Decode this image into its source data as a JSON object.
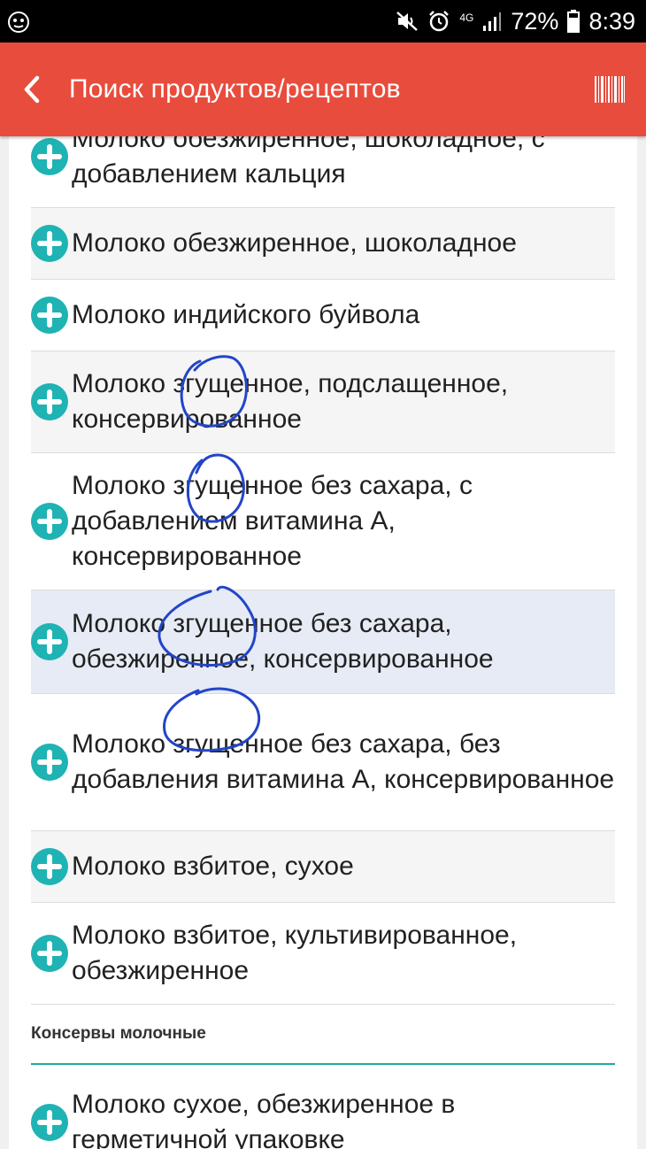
{
  "status_bar": {
    "signal_label": "4G",
    "battery_text": "72%",
    "time": "8:39"
  },
  "app_bar": {
    "title": "Поиск продуктов/рецептов"
  },
  "list": {
    "items": [
      {
        "label": "Молоко обезжиренное, шоколадное, с добавлением кальция"
      },
      {
        "label": "Молоко обезжиренное, шоколадное"
      },
      {
        "label": "Молоко индийского буйвола"
      },
      {
        "label": "Молоко згущенное, подслащенное, консервированное"
      },
      {
        "label": "Молоко згущенное без сахара, с добавлением витамина А, консервированное"
      },
      {
        "label": "Молоко згущенное без сахара, обезжиренное, консервированное"
      },
      {
        "label": "Молоко згущенное без сахара, без добавления витамина А, консервированное"
      },
      {
        "label": "Молоко взбитое, сухое"
      },
      {
        "label": "Молоко взбитое, культивированное, обезжиренное"
      }
    ],
    "section_header": "Консервы молочные",
    "section_items": [
      {
        "label": "Молоко сухое, обезжиренное в герметичной упаковке"
      }
    ]
  },
  "colors": {
    "accent": "#e84c3d",
    "plus_icon": "#1fb3b3",
    "section_underline": "#26a6a8",
    "selected_row": "#e6ebf5",
    "annotation": "#2245c8"
  }
}
